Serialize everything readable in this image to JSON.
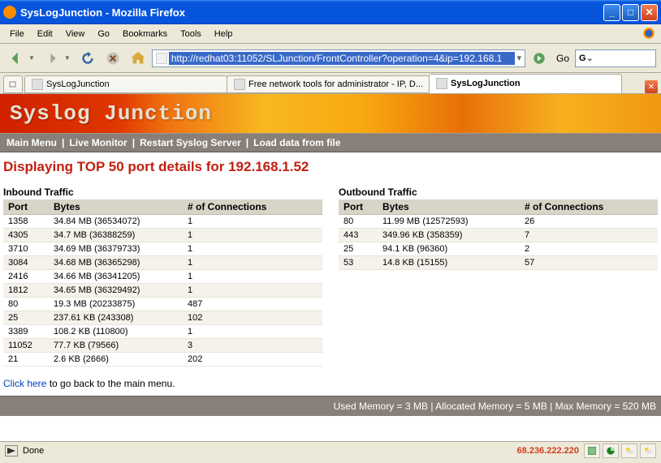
{
  "window": {
    "title": "SysLogJunction - Mozilla Firefox"
  },
  "menu": {
    "file": "File",
    "edit": "Edit",
    "view": "View",
    "go": "Go",
    "bookmarks": "Bookmarks",
    "tools": "Tools",
    "help": "Help"
  },
  "nav": {
    "url": "http://redhat03:11052/SLJunction/FrontController?operation=4&ip=192.168.1",
    "go_label": "Go",
    "search_placeholder": "G"
  },
  "tabs": [
    {
      "label": "SysLogJunction",
      "active": false
    },
    {
      "label": "Free network tools for administrator - IP, D...",
      "active": false
    },
    {
      "label": "SysLogJunction",
      "active": true
    }
  ],
  "app": {
    "brand": "Syslog Junction",
    "nav": {
      "main": "Main Menu",
      "live": "Live Monitor",
      "restart": "Restart Syslog Server",
      "load": "Load data from file"
    },
    "heading": "Displaying TOP 50 port details for 192.168.1.52",
    "inbound_title": "Inbound Traffic",
    "outbound_title": "Outbound Traffic",
    "cols": {
      "port": "Port",
      "bytes": "Bytes",
      "conn": "# of Connections"
    },
    "inbound": [
      {
        "port": "1358",
        "bytes": "34.84 MB (36534072)",
        "conn": "1"
      },
      {
        "port": "4305",
        "bytes": "34.7 MB (36388259)",
        "conn": "1"
      },
      {
        "port": "3710",
        "bytes": "34.69 MB (36379733)",
        "conn": "1"
      },
      {
        "port": "3084",
        "bytes": "34.68 MB (36365298)",
        "conn": "1"
      },
      {
        "port": "2416",
        "bytes": "34.66 MB (36341205)",
        "conn": "1"
      },
      {
        "port": "1812",
        "bytes": "34.65 MB (36329492)",
        "conn": "1"
      },
      {
        "port": "80",
        "bytes": "19.3 MB (20233875)",
        "conn": "487"
      },
      {
        "port": "25",
        "bytes": "237.61 KB (243308)",
        "conn": "102"
      },
      {
        "port": "3389",
        "bytes": "108.2 KB (110800)",
        "conn": "1"
      },
      {
        "port": "11052",
        "bytes": "77.7 KB (79566)",
        "conn": "3"
      },
      {
        "port": "21",
        "bytes": "2.6 KB (2666)",
        "conn": "202"
      }
    ],
    "outbound": [
      {
        "port": "80",
        "bytes": "11.99 MB (12572593)",
        "conn": "26"
      },
      {
        "port": "443",
        "bytes": "349.96 KB (358359)",
        "conn": "7"
      },
      {
        "port": "25",
        "bytes": "94.1 KB (96360)",
        "conn": "2"
      },
      {
        "port": "53",
        "bytes": "14.8 KB (15155)",
        "conn": "57"
      }
    ],
    "back_link": "Click here",
    "back_text": " to go back to the main menu.",
    "mem": "Used Memory = 3 MB | Allocated Memory = 5 MB | Max Memory = 520 MB"
  },
  "status": {
    "text": "Done",
    "ip": "68.236.222.220"
  },
  "chart_data": {
    "type": "table",
    "title": "Displaying TOP 50 port details for 192.168.1.52",
    "tables": [
      {
        "name": "Inbound Traffic",
        "columns": [
          "Port",
          "Bytes",
          "# of Connections"
        ],
        "rows": [
          [
            1358,
            36534072,
            1
          ],
          [
            4305,
            36388259,
            1
          ],
          [
            3710,
            36379733,
            1
          ],
          [
            3084,
            36365298,
            1
          ],
          [
            2416,
            36341205,
            1
          ],
          [
            1812,
            36329492,
            1
          ],
          [
            80,
            20233875,
            487
          ],
          [
            25,
            243308,
            102
          ],
          [
            3389,
            110800,
            1
          ],
          [
            11052,
            79566,
            3
          ],
          [
            21,
            2666,
            202
          ]
        ]
      },
      {
        "name": "Outbound Traffic",
        "columns": [
          "Port",
          "Bytes",
          "# of Connections"
        ],
        "rows": [
          [
            80,
            12572593,
            26
          ],
          [
            443,
            358359,
            7
          ],
          [
            25,
            96360,
            2
          ],
          [
            53,
            15155,
            57
          ]
        ]
      }
    ]
  }
}
